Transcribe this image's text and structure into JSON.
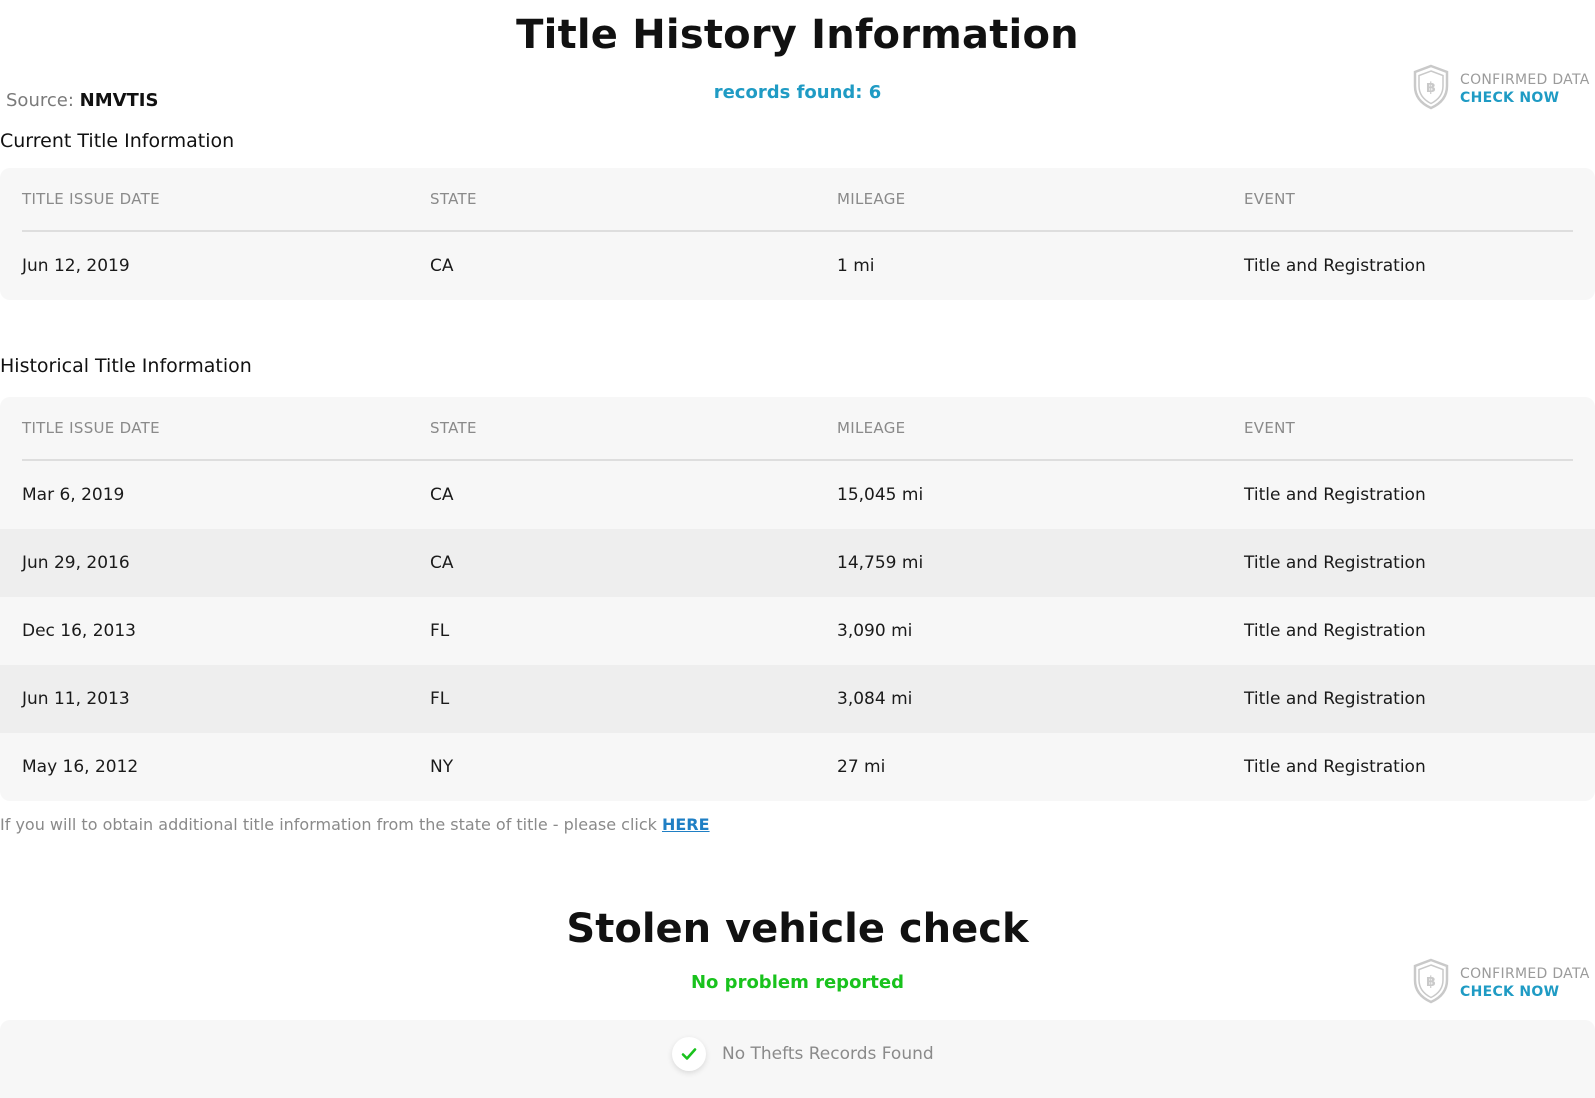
{
  "header": {
    "title": "Title History Information",
    "source_label": "Source:",
    "source_value": "NMVTIS",
    "records_found": "records found: 6"
  },
  "badge": {
    "line1": "CONFIRMED DATA",
    "line2": "CHECK NOW",
    "icon": "shield-bitcoin-icon"
  },
  "current_title": {
    "heading": "Current Title Information",
    "columns": [
      "TITLE ISSUE DATE",
      "STATE",
      "MILEAGE",
      "EVENT"
    ],
    "rows": [
      {
        "date": "Jun 12, 2019",
        "state": "CA",
        "mileage": "1 mi",
        "event": "Title and Registration"
      }
    ]
  },
  "historical_title": {
    "heading": "Historical Title Information",
    "columns": [
      "TITLE ISSUE DATE",
      "STATE",
      "MILEAGE",
      "EVENT"
    ],
    "rows": [
      {
        "date": "Mar 6, 2019",
        "state": "CA",
        "mileage": "15,045 mi",
        "event": "Title and Registration"
      },
      {
        "date": "Jun 29, 2016",
        "state": "CA",
        "mileage": "14,759 mi",
        "event": "Title and Registration"
      },
      {
        "date": "Dec 16, 2013",
        "state": "FL",
        "mileage": "3,090 mi",
        "event": "Title and Registration"
      },
      {
        "date": "Jun 11, 2013",
        "state": "FL",
        "mileage": "3,084 mi",
        "event": "Title and Registration"
      },
      {
        "date": "May 16, 2012",
        "state": "NY",
        "mileage": "27 mi",
        "event": "Title and Registration"
      }
    ]
  },
  "note": {
    "text": "If you will to obtain additional title information from the state of title - please click ",
    "link": "HERE"
  },
  "stolen": {
    "title": "Stolen vehicle check",
    "status": "No problem reported",
    "result": "No Thefts Records Found",
    "icon": "checkmark-icon"
  },
  "colors": {
    "accent_blue": "#1f9bc4",
    "success_green": "#19c21d",
    "muted_gray": "#8a8a8a",
    "table_bg": "#f7f7f7",
    "row_alt_bg": "#eeeeee"
  }
}
